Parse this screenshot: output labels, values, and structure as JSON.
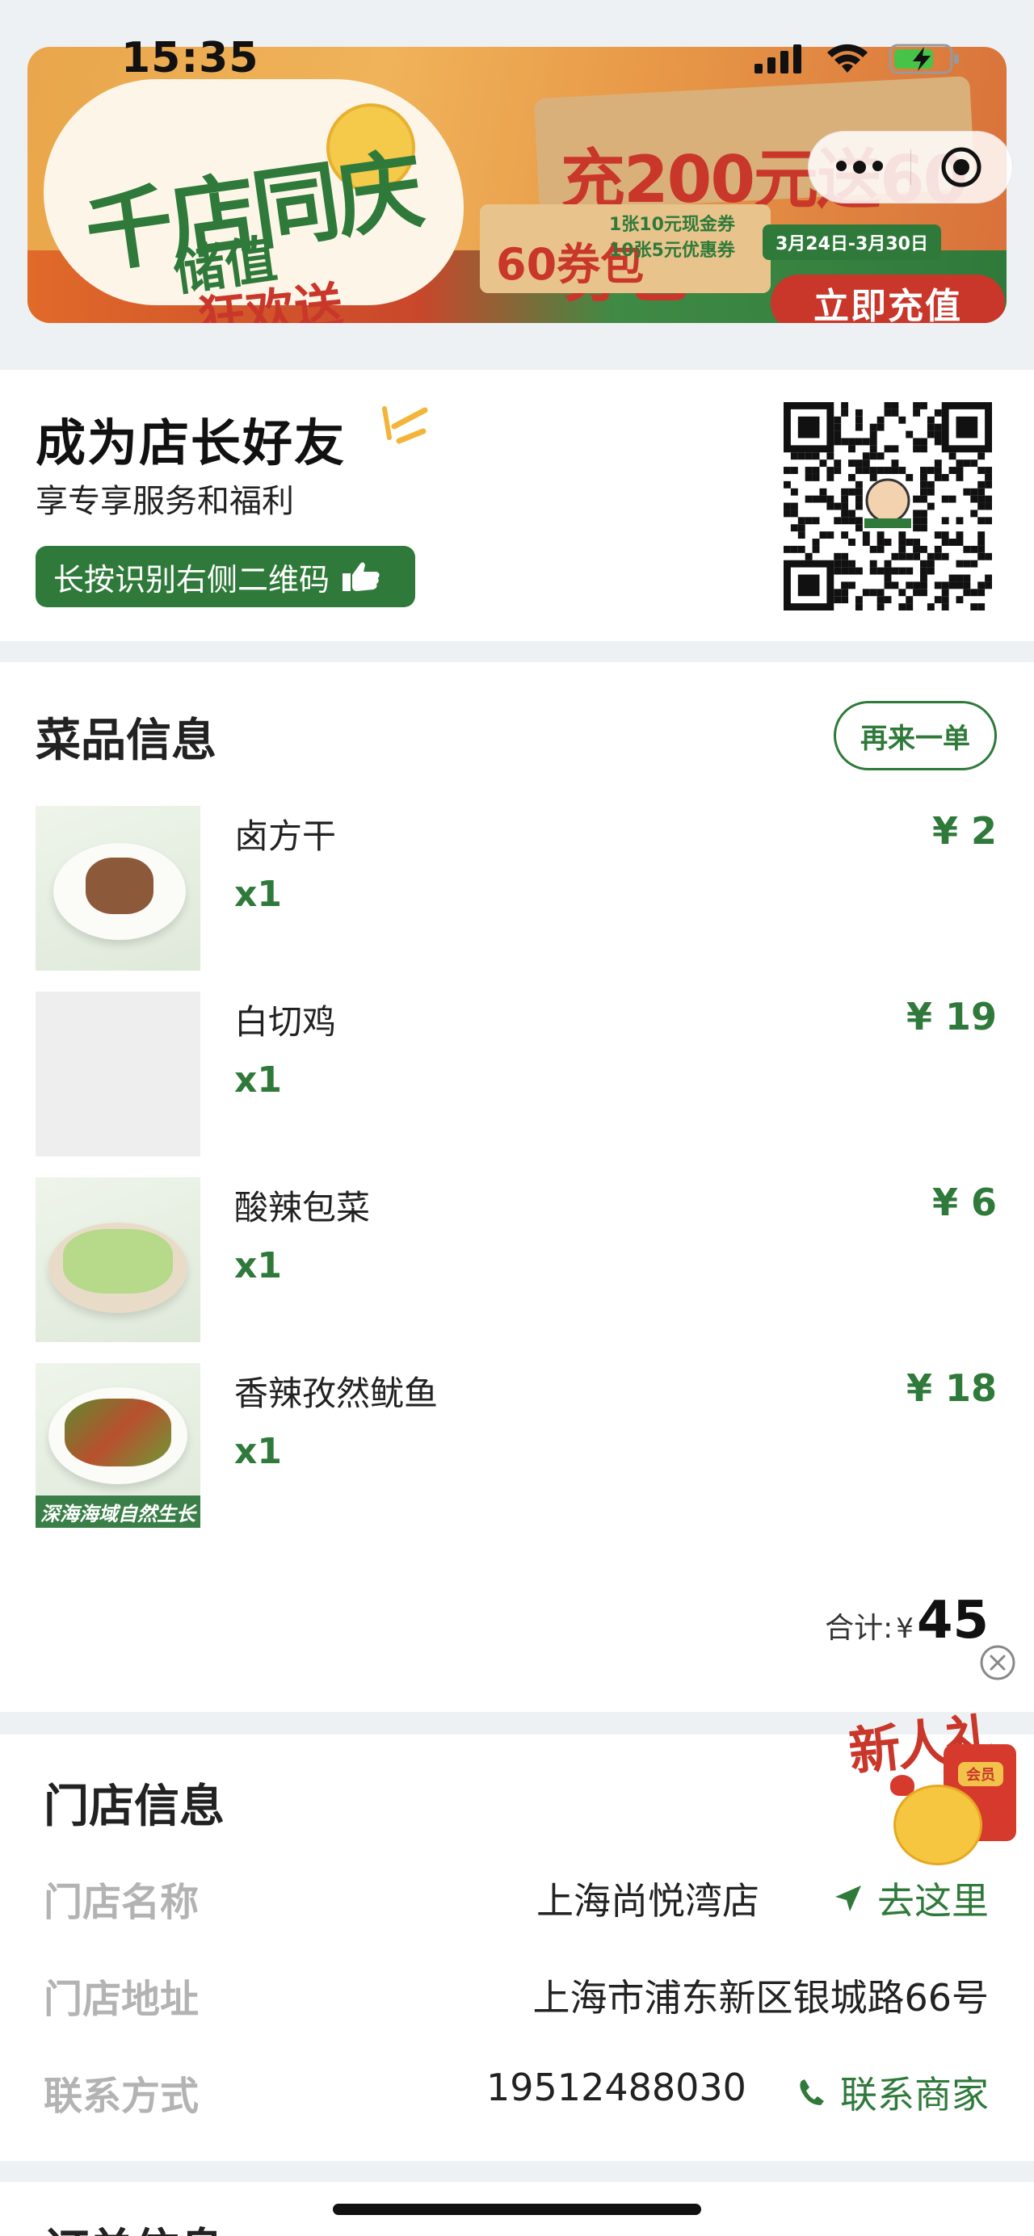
{
  "status_bar": {
    "time": "15:35"
  },
  "banner": {
    "title_line1": "千店同庆",
    "title_line2": "储值",
    "title_line3": "狂欢送",
    "promo": "充200元送60券包",
    "board_left": "60券包",
    "board_right_1": "1张10元现金券",
    "board_right_2": "10张5元优惠券",
    "date": "3月24日-3月30日",
    "cta": "立即充值"
  },
  "friend": {
    "title": "成为店长好友",
    "subtitle": "享专享服务和福利",
    "button": "长按识别右侧二维码"
  },
  "items": {
    "title": "菜品信息",
    "reorder": "再来一单",
    "list": [
      {
        "name": "卤方干",
        "qty": "x1",
        "price": "¥ 2"
      },
      {
        "name": "白切鸡",
        "qty": "x1",
        "price": "¥ 19"
      },
      {
        "name": "酸辣包菜",
        "qty": "x1",
        "price": "¥ 6"
      },
      {
        "name": "香辣孜然鱿鱼",
        "qty": "x1",
        "price": "¥ 18",
        "caption": "深海海域自然生长"
      }
    ],
    "total_label": "合计:",
    "total_currency": "¥",
    "total_value": "45"
  },
  "store": {
    "title": "门店信息",
    "name_label": "门店名称",
    "name_value": "上海尚悦湾店",
    "navigate": "去这里",
    "address_label": "门店地址",
    "address_value": "上海市浦东新区银城路66号",
    "contact_label": "联系方式",
    "contact_value": "19512488030",
    "call": "联系商家"
  },
  "float_gift": {
    "text": "新人礼",
    "envelope": "会员"
  },
  "order": {
    "title": "订单信息"
  },
  "colors": {
    "accent": "#2f7a3a",
    "banner_red": "#c9372b",
    "page_bg": "#eef1f3"
  }
}
